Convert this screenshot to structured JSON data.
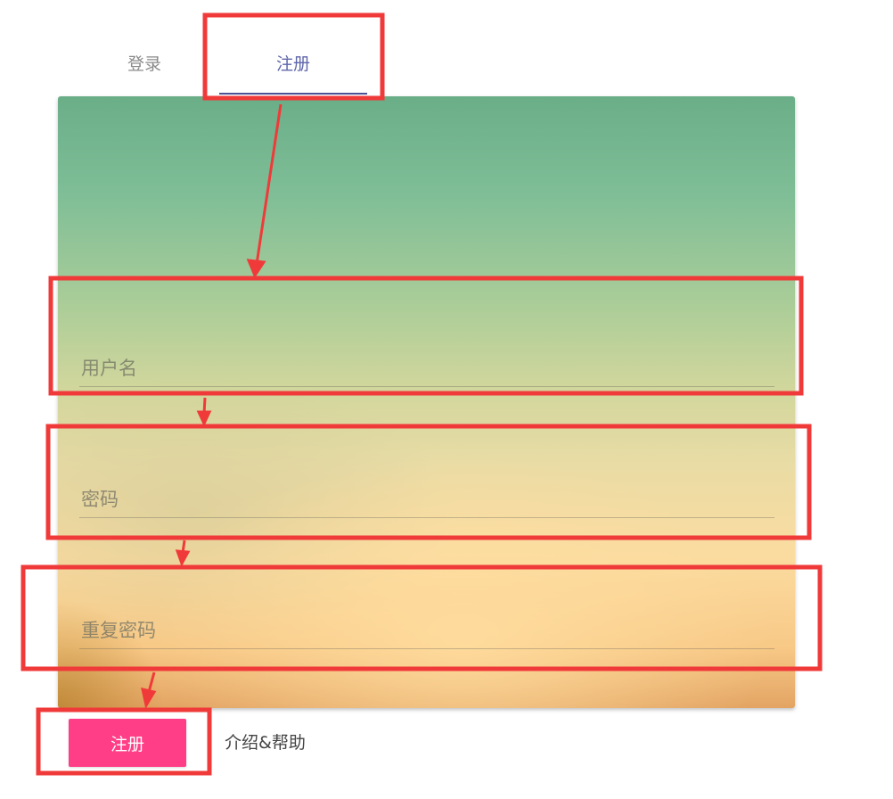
{
  "tabs": {
    "login_label": "登录",
    "register_label": "注册"
  },
  "form": {
    "username_placeholder": "用户名",
    "password_placeholder": "密码",
    "repeat_password_placeholder": "重复密码"
  },
  "actions": {
    "register_label": "注册",
    "help_label": "介绍&帮助"
  },
  "colors": {
    "tab_active": "#5f66aa",
    "tab_indicator": "#4b5195",
    "register_button": "#ff3e87",
    "annotation": "#f03a3a"
  }
}
